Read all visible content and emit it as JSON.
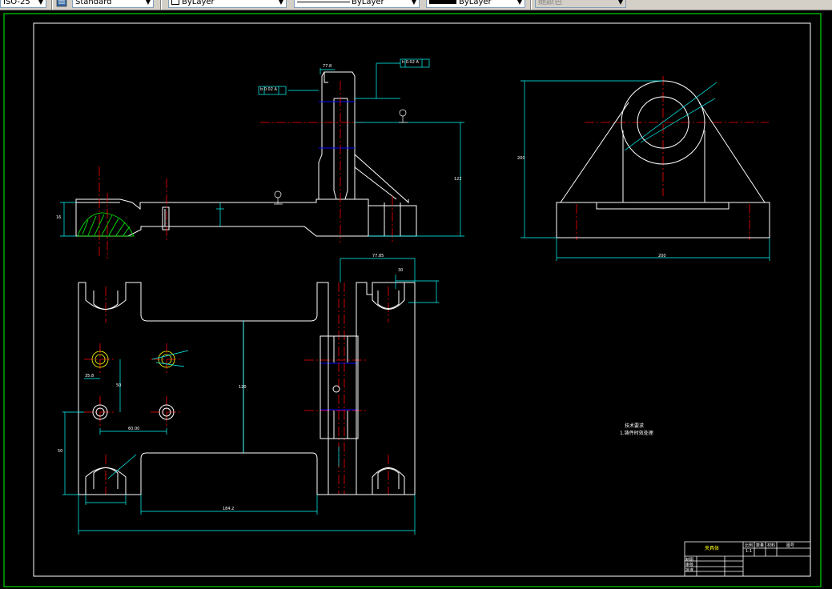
{
  "toolbar": {
    "textstyle_value": "ISO-25",
    "dimstyle_value": "Standard",
    "layer_color_value": "ByLayer",
    "linetype_value": "ByLayer",
    "lineweight_value": "ByLayer",
    "plotstyle_value": "随颜色"
  },
  "drawing": {
    "background": "#000000",
    "outer_border_color": "#00ff00",
    "inner_border_color": "#ffffff",
    "part_line_color": "#ffffff",
    "center_line_color": "#ff0000",
    "dimension_color": "#00ffff",
    "hidden_line_color": "#0000ff",
    "hatch_color": "#00ff00",
    "hole_color": "#ffff00",
    "tech_notes": {
      "title": "技术要求",
      "line1": "1.铸件时效处理"
    },
    "title_block": {
      "drawing_name": "夹具体",
      "ratio_label": "比例",
      "quantity_label": "数量",
      "material_label": "材料",
      "sheet_label": "图号",
      "ratio_value": "1:1",
      "drawn_label": "制图",
      "checked_label": "审核",
      "approved_label": "批准"
    },
    "dim_labels": {
      "top_width": "77.8",
      "front_height": "16",
      "side_height": "122",
      "side_width": "200",
      "bottom_width": "200",
      "plan_depth": "77.85",
      "slot_width": "30",
      "hole_pitch_x": "60.00",
      "hole_pitch_y": "50",
      "hole_pos": "35.8",
      "lower_slot": "184.2",
      "center_height": "120",
      "edge_dist": "50"
    },
    "symbols": {
      "gdt_left": "b 0.02 A",
      "gdt_right": "h 0.02 A"
    }
  }
}
